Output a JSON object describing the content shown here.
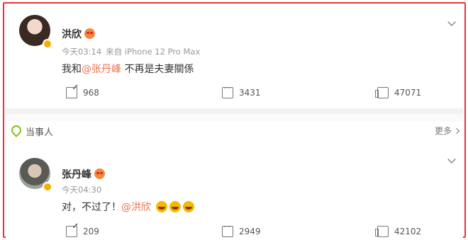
{
  "post1": {
    "author": "洪欣",
    "time": "今天03:14",
    "source": "来自 iPhone 12 Pro Max",
    "text_before": "我和",
    "mention": "@张丹峰",
    "text_after": " 不再是夫妻關係",
    "shares": "968",
    "comments": "3431",
    "likes": "47071"
  },
  "party": {
    "label": "当事人",
    "more": "更多"
  },
  "post2": {
    "author": "张丹峰",
    "time": "今天04:30",
    "text_before": "对，不过了！",
    "mention": "@洪欣",
    "shares": "209",
    "comments": "2949",
    "likes": "42102"
  },
  "colors": {
    "frame": "#e8323a",
    "mention": "#eb7350",
    "verified": "#f5b000",
    "party_icon": "#84c31d"
  }
}
